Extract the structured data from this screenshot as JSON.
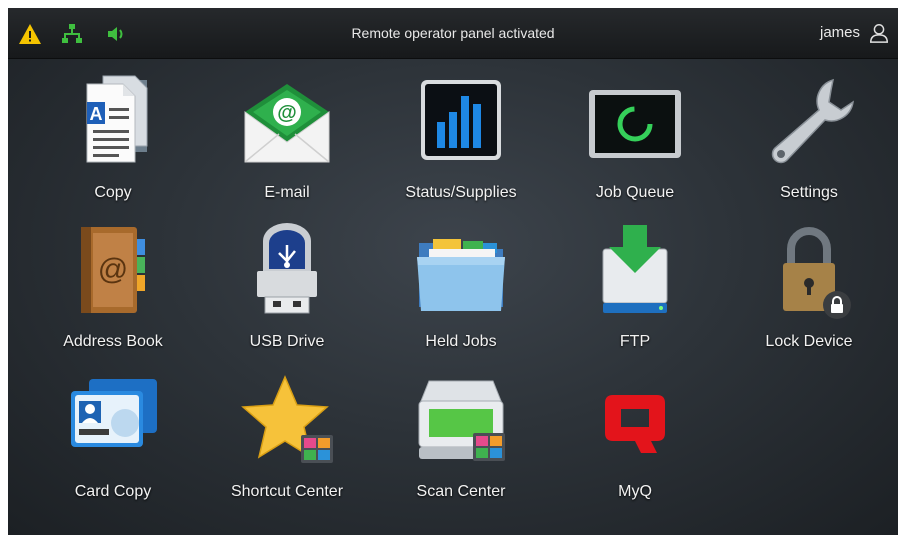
{
  "topbar": {
    "status_text": "Remote operator panel activated",
    "user_name": "james",
    "icons": [
      "warning-icon",
      "network-icon",
      "speaker-icon",
      "user-icon"
    ]
  },
  "apps": [
    {
      "label": "Copy",
      "icon": "copy-icon"
    },
    {
      "label": "E-mail",
      "icon": "email-icon"
    },
    {
      "label": "Status/Supplies",
      "icon": "status-supplies-icon"
    },
    {
      "label": "Job Queue",
      "icon": "job-queue-icon"
    },
    {
      "label": "Settings",
      "icon": "wrench-icon"
    },
    {
      "label": "Address Book",
      "icon": "address-book-icon"
    },
    {
      "label": "USB Drive",
      "icon": "usb-drive-icon"
    },
    {
      "label": "Held Jobs",
      "icon": "folder-icon"
    },
    {
      "label": "FTP",
      "icon": "ftp-icon"
    },
    {
      "label": "Lock Device",
      "icon": "padlock-icon"
    },
    {
      "label": "Card Copy",
      "icon": "id-card-icon"
    },
    {
      "label": "Shortcut Center",
      "icon": "star-icon"
    },
    {
      "label": "Scan Center",
      "icon": "scanner-icon"
    },
    {
      "label": "MyQ",
      "icon": "myq-logo-icon"
    }
  ],
  "colors": {
    "warning": "#f5c400",
    "network": "#3fbf3f",
    "myq_red": "#e3141b",
    "email_green": "#1f8f3a"
  }
}
